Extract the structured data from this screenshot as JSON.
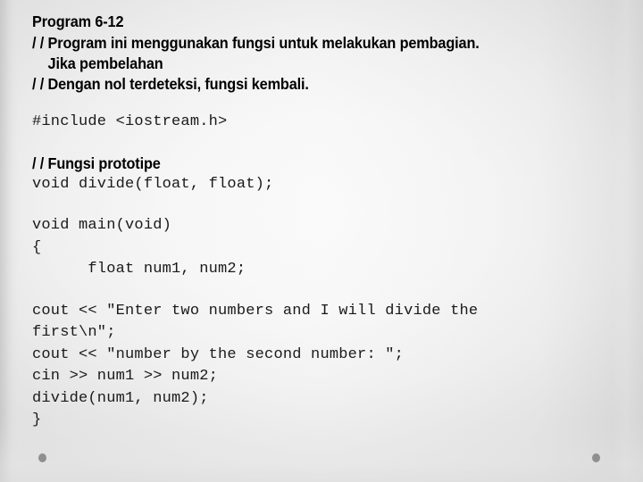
{
  "slide": {
    "title": "Program 6-12",
    "comments": [
      "/ / Program ini menggunakan fungsi untuk melakukan pembagian.",
      "    Jika pembelahan",
      "/ / Dengan nol terdeteksi, fungsi kembali."
    ],
    "include_line": "#include <iostream.h>",
    "prototype_comment": "/ / Fungsi prototipe",
    "prototype_line": "void divide(float, float);",
    "code_lines": [
      "void main(void)",
      "{",
      "      float num1, num2;",
      "",
      "cout << \"Enter two numbers and I will divide the",
      "first\\n\";",
      "cout << \"number by the second number: \";",
      "cin >> num1 >> num2;",
      "divide(num1, num2);",
      "}"
    ],
    "decor": {
      "dot_left": "bullet-dot",
      "dot_right": "bullet-dot",
      "dot_color": "#8f8f8f"
    },
    "background": {
      "base_color": "#fafafa",
      "edge_color": "#e0e0e0"
    },
    "text_color": "#000000"
  }
}
